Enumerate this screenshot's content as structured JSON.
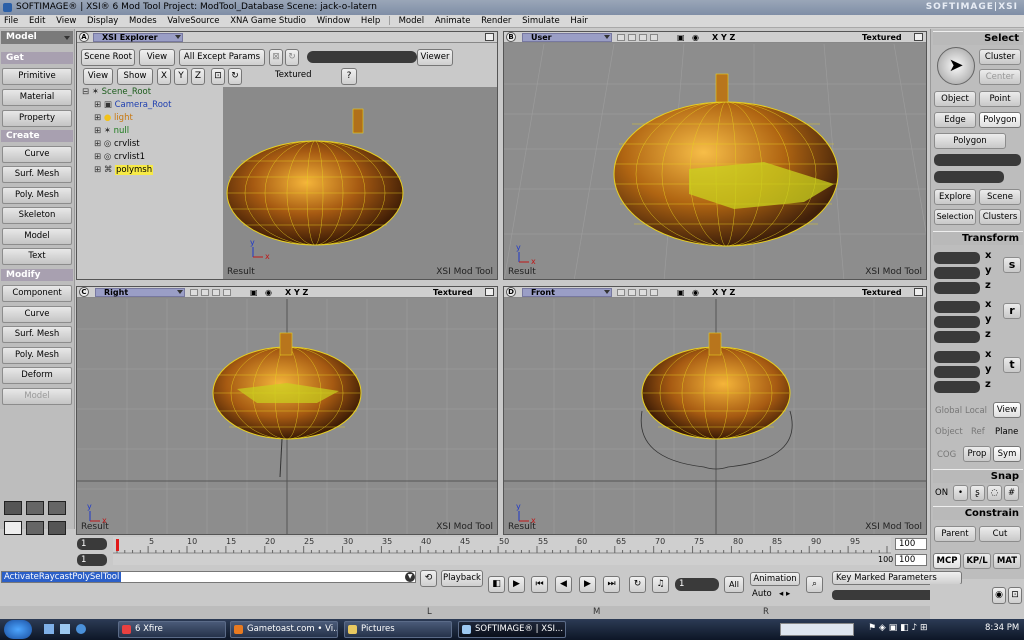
{
  "window": {
    "title": "SOFTIMAGE® | XSI® 6 Mod Tool Project: ModTool_Database     Scene: jack-o-latern",
    "brand": "SOFTIMAGE|XSI"
  },
  "menu": [
    "File",
    "Edit",
    "View",
    "Display",
    "Modes",
    "ValveSource",
    "XNA Game Studio",
    "Window",
    "Help",
    "Model",
    "Animate",
    "Render",
    "Simulate",
    "Hair"
  ],
  "left_panel": {
    "mode": "Model",
    "sections": {
      "get": "Get",
      "create": "Create",
      "modify": "Modify"
    },
    "get_buttons": [
      "Primitive",
      "Material",
      "Property"
    ],
    "create_buttons": [
      "Curve",
      "Surf. Mesh",
      "Poly. Mesh",
      "Skeleton",
      "Model",
      "Text"
    ],
    "modify_buttons": [
      "Component",
      "Curve",
      "Surf. Mesh",
      "Poly. Mesh",
      "Deform",
      "Model"
    ]
  },
  "explorer": {
    "letter": "A",
    "title": "XSI Explorer",
    "toolbar": [
      "Scene Root",
      "View",
      "All Except Params",
      "Viewer"
    ],
    "toolbar2": [
      "View",
      "Show",
      "X",
      "Y",
      "Z",
      "Textured"
    ],
    "tree": [
      "Scene_Root",
      "Camera_Root",
      "light",
      "null",
      "crvlist",
      "crvlist1",
      "polymsh"
    ]
  },
  "viewports": {
    "a": {
      "footer_left": "Result",
      "footer_right": "XSI Mod Tool"
    },
    "b": {
      "letter": "B",
      "camera": "User",
      "axes": "X Y Z",
      "display": "Textured",
      "footer_left": "Result",
      "footer_right": "XSI Mod Tool"
    },
    "c": {
      "letter": "C",
      "camera": "Right",
      "axes": "X Y Z",
      "display": "Textured",
      "footer_left": "Result",
      "footer_right": "XSI Mod Tool"
    },
    "d": {
      "letter": "D",
      "camera": "Front",
      "axes": "X Y Z",
      "display": "Textured",
      "footer_left": "Result",
      "footer_right": "XSI Mod Tool"
    }
  },
  "right_panel": {
    "select": "Select",
    "select_buttons": [
      "Cluster",
      "Center",
      "Object",
      "Point",
      "Edge",
      "Polygon",
      "Polygon"
    ],
    "explore_buttons": [
      "Explore",
      "Scene",
      "Selection",
      "Clusters"
    ],
    "transform": "Transform",
    "axes": [
      "x",
      "y",
      "z"
    ],
    "ref_labels": [
      "Global",
      "Local",
      "View",
      "Object",
      "Ref",
      "Plane",
      "COG",
      "Prop",
      "Sym"
    ],
    "snap": "Snap",
    "snap_on": "ON",
    "constrain": "Constrain",
    "constrain_buttons": [
      "Parent",
      "Cut"
    ],
    "tabs": [
      "MCP",
      "KP/L",
      "MAT"
    ]
  },
  "timeline": {
    "start": "1",
    "start2": "1",
    "end": "100",
    "end2": "100",
    "ticks": [
      "1",
      "5",
      "10",
      "15",
      "20",
      "25",
      "30",
      "35",
      "40",
      "45",
      "50",
      "55",
      "60",
      "65",
      "70",
      "75",
      "80",
      "85",
      "90",
      "95",
      "100"
    ],
    "tick_labels": [
      "5",
      "10",
      "15",
      "20",
      "25",
      "30",
      "35",
      "40",
      "45",
      "50",
      "55",
      "60",
      "65",
      "70",
      "75",
      "80",
      "85",
      "90",
      "95"
    ],
    "end_label": "100"
  },
  "bottom": {
    "command": "ActivateRaycastPolySelTool",
    "playback": "Playback",
    "frame": "1",
    "all": "All",
    "animation": "Animation",
    "auto": "Auto",
    "key_marked": "Key Marked Parameters",
    "mouse_labels": [
      "L",
      "M",
      "R"
    ]
  },
  "taskbar": {
    "items": [
      "6 Xfire",
      "Gametoast.com • Vi...",
      "Pictures",
      "SOFTIMAGE® | XSI..."
    ],
    "time": "8:34 PM"
  }
}
